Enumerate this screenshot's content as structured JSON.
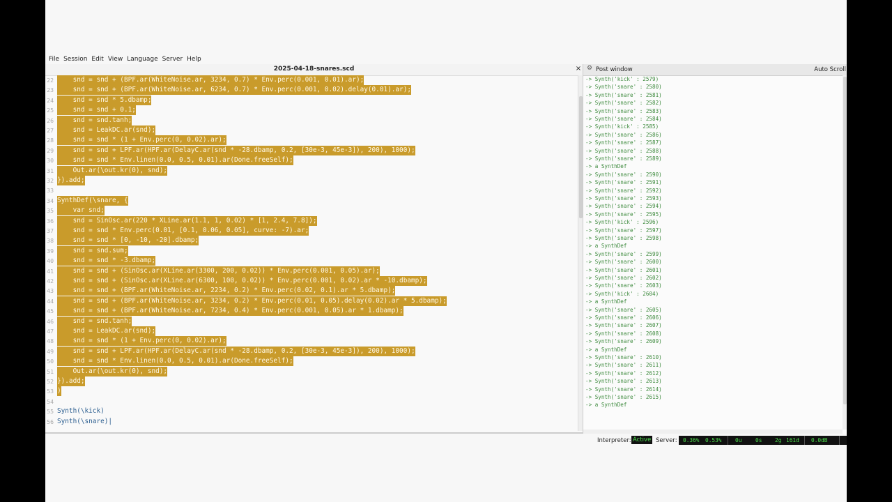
{
  "menu": [
    "File",
    "Session",
    "Edit",
    "View",
    "Language",
    "Server",
    "Help"
  ],
  "document": {
    "title": "2025-04-18-snares.scd",
    "close_icon": "×"
  },
  "code_lines": [
    {
      "n": "22",
      "t": "    snd = snd + (BPF.ar(WhiteNoise.ar, 3234, 0.7) * Env.perc(0.001, 0.01).ar);",
      "hl": true
    },
    {
      "n": "23",
      "t": "    snd = snd + (BPF.ar(WhiteNoise.ar, 6234, 0.7) * Env.perc(0.001, 0.02).delay(0.01).ar);",
      "hl": true
    },
    {
      "n": "24",
      "t": "    snd = snd * 5.dbamp;",
      "hl": true
    },
    {
      "n": "25",
      "t": "    snd = snd + 0.1;",
      "hl": true
    },
    {
      "n": "26",
      "t": "    snd = snd.tanh;",
      "hl": true
    },
    {
      "n": "27",
      "t": "    snd = LeakDC.ar(snd);",
      "hl": true
    },
    {
      "n": "28",
      "t": "    snd = snd * (1 + Env.perc(0, 0.02).ar);",
      "hl": true
    },
    {
      "n": "29",
      "t": "    snd = snd + LPF.ar(HPF.ar(DelayC.ar(snd * -28.dbamp, 0.2, [30e-3, 45e-3]), 200), 1000);",
      "hl": true
    },
    {
      "n": "30",
      "t": "    snd = snd * Env.linen(0.0, 0.5, 0.01).ar(Done.freeSelf);",
      "hl": true
    },
    {
      "n": "31",
      "t": "    Out.ar(\\out.kr(0), snd);",
      "hl": true
    },
    {
      "n": "32",
      "t": "}).add;",
      "hl": true
    },
    {
      "n": "33",
      "t": "",
      "hl": false
    },
    {
      "n": "34",
      "t": "SynthDef(\\snare, {",
      "hl": true
    },
    {
      "n": "35",
      "t": "    var snd;",
      "hl": true
    },
    {
      "n": "36",
      "t": "    snd = SinOsc.ar(220 * XLine.ar(1.1, 1, 0.02) * [1, 2.4, 7.8]);",
      "hl": true
    },
    {
      "n": "37",
      "t": "    snd = snd * Env.perc(0.01, [0.1, 0.06, 0.05], curve: -7).ar;",
      "hl": true
    },
    {
      "n": "38",
      "t": "    snd = snd * [0, -10, -20].dbamp;",
      "hl": true
    },
    {
      "n": "39",
      "t": "    snd = snd.sum;",
      "hl": true
    },
    {
      "n": "40",
      "t": "    snd = snd * -3.dbamp;",
      "hl": true
    },
    {
      "n": "41",
      "t": "    snd = snd + (SinOsc.ar(XLine.ar(3300, 200, 0.02)) * Env.perc(0.001, 0.05).ar);",
      "hl": true
    },
    {
      "n": "42",
      "t": "    snd = snd + (SinOsc.ar(XLine.ar(6300, 100, 0.02)) * Env.perc(0.001, 0.02).ar * -10.dbamp);",
      "hl": true
    },
    {
      "n": "43",
      "t": "    snd = snd + (BPF.ar(WhiteNoise.ar, 2234, 0.2) * Env.perc(0.02, 0.1).ar * 5.dbamp);",
      "hl": true
    },
    {
      "n": "44",
      "t": "    snd = snd + (BPF.ar(WhiteNoise.ar, 3234, 0.2) * Env.perc(0.01, 0.05).delay(0.02).ar * 5.dbamp);",
      "hl": true
    },
    {
      "n": "45",
      "t": "    snd = snd + (BPF.ar(WhiteNoise.ar, 7234, 0.4) * Env.perc(0.001, 0.05).ar * 1.dbamp);",
      "hl": true
    },
    {
      "n": "46",
      "t": "    snd = snd.tanh;",
      "hl": true
    },
    {
      "n": "47",
      "t": "    snd = LeakDC.ar(snd);",
      "hl": true
    },
    {
      "n": "48",
      "t": "    snd = snd * (1 + Env.perc(0, 0.02).ar);",
      "hl": true
    },
    {
      "n": "49",
      "t": "    snd = snd + LPF.ar(HPF.ar(DelayC.ar(snd * -28.dbamp, 0.2, [30e-3, 45e-3]), 200), 1000);",
      "hl": true
    },
    {
      "n": "50",
      "t": "    snd = snd * Env.linen(0.0, 0.5, 0.01).ar(Done.freeSelf);",
      "hl": true
    },
    {
      "n": "51",
      "t": "    Out.ar(\\out.kr(0), snd);",
      "hl": true
    },
    {
      "n": "52",
      "t": "}).add;",
      "hl": true
    },
    {
      "n": "53",
      "t": ")",
      "hl": true
    },
    {
      "n": "54",
      "t": "",
      "hl": false
    },
    {
      "n": "55",
      "t": "Synth(\\kick)",
      "hl": false
    },
    {
      "n": "56",
      "t": "Synth(\\snare)|",
      "hl": false
    }
  ],
  "post_window": {
    "title": "Post window",
    "auto_scroll": "Auto Scroll",
    "gear_icon": "⚙",
    "lines": [
      "-> Synth('kick' : 2579)",
      "-> Synth('snare' : 2580)",
      "-> Synth('snare' : 2581)",
      "-> Synth('snare' : 2582)",
      "-> Synth('snare' : 2583)",
      "-> Synth('snare' : 2584)",
      "-> Synth('kick' : 2585)",
      "-> Synth('snare' : 2586)",
      "-> Synth('snare' : 2587)",
      "-> Synth('snare' : 2588)",
      "-> Synth('snare' : 2589)",
      "-> a SynthDef",
      "-> Synth('snare' : 2590)",
      "-> Synth('snare' : 2591)",
      "-> Synth('snare' : 2592)",
      "-> Synth('snare' : 2593)",
      "-> Synth('snare' : 2594)",
      "-> Synth('snare' : 2595)",
      "-> Synth('kick' : 2596)",
      "-> Synth('snare' : 2597)",
      "-> Synth('snare' : 2598)",
      "-> a SynthDef",
      "-> Synth('snare' : 2599)",
      "-> Synth('snare' : 2600)",
      "-> Synth('snare' : 2601)",
      "-> Synth('snare' : 2602)",
      "-> Synth('snare' : 2603)",
      "-> Synth('kick' : 2604)",
      "-> a SynthDef",
      "-> Synth('snare' : 2605)",
      "-> Synth('snare' : 2606)",
      "-> Synth('snare' : 2607)",
      "-> Synth('snare' : 2608)",
      "-> Synth('snare' : 2609)",
      "-> a SynthDef",
      "-> Synth('snare' : 2610)",
      "-> Synth('snare' : 2611)",
      "-> Synth('snare' : 2612)",
      "-> Synth('snare' : 2613)",
      "-> Synth('snare' : 2614)",
      "-> Synth('snare' : 2615)",
      "-> a SynthDef"
    ]
  },
  "status": {
    "interpreter_label": "Interpreter:",
    "interpreter_state": "Active",
    "server_label": "Server:",
    "avg_cpu": "0.36%",
    "peak_cpu": "0.53%",
    "ugens": "0u",
    "synths": "0s",
    "groups": "2g",
    "synthdefs": "161d",
    "volume": "0.0dB"
  },
  "colors": {
    "selection": "#c99b2b",
    "post_text": "#3d8a3d",
    "status_text": "#4ddf4d"
  }
}
